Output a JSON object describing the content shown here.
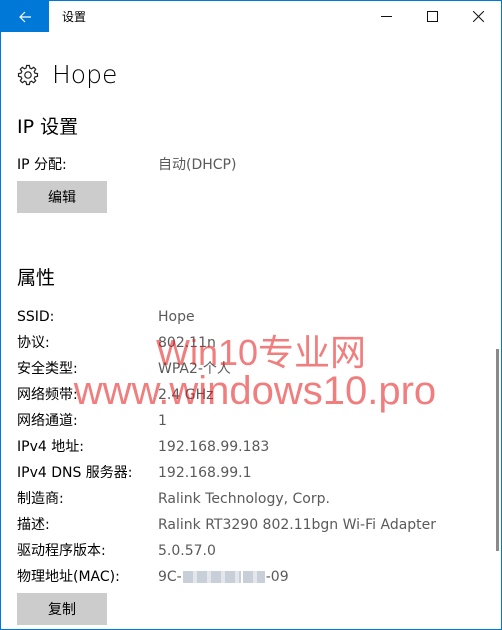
{
  "window": {
    "title": "设置",
    "accent_color": "#0078d7"
  },
  "icons": {
    "back": "back-arrow-icon",
    "minimize": "minimize-icon",
    "maximize": "maximize-icon",
    "close": "close-icon",
    "settings": "gear-icon"
  },
  "page": {
    "title": "Hope"
  },
  "ip_settings": {
    "heading": "IP 设置",
    "assignment_label": "IP 分配:",
    "assignment_value": "自动(DHCP)",
    "edit_button": "编辑"
  },
  "properties": {
    "heading": "属性",
    "rows": [
      {
        "label": "SSID:",
        "value": "Hope"
      },
      {
        "label": "协议:",
        "value": "802.11n"
      },
      {
        "label": "安全类型:",
        "value": "WPA2-个人"
      },
      {
        "label": "网络频带:",
        "value": "2.4 GHz"
      },
      {
        "label": "网络通道:",
        "value": "1"
      },
      {
        "label": "IPv4 地址:",
        "value": "192.168.99.183"
      },
      {
        "label": "IPv4 DNS 服务器:",
        "value": "192.168.99.1"
      },
      {
        "label": "制造商:",
        "value": "Ralink Technology, Corp."
      },
      {
        "label": "描述:",
        "value": "Ralink RT3290 802.11bgn Wi-Fi Adapter"
      },
      {
        "label": "驱动程序版本:",
        "value": "5.0.57.0"
      }
    ],
    "mac_label": "物理地址(MAC):",
    "mac_prefix": "9C-",
    "mac_suffix": "-09",
    "copy_button": "复制"
  },
  "watermark": {
    "line1": "Win10专业网",
    "line2": "www.windows10.pro",
    "color": "#e61414"
  }
}
